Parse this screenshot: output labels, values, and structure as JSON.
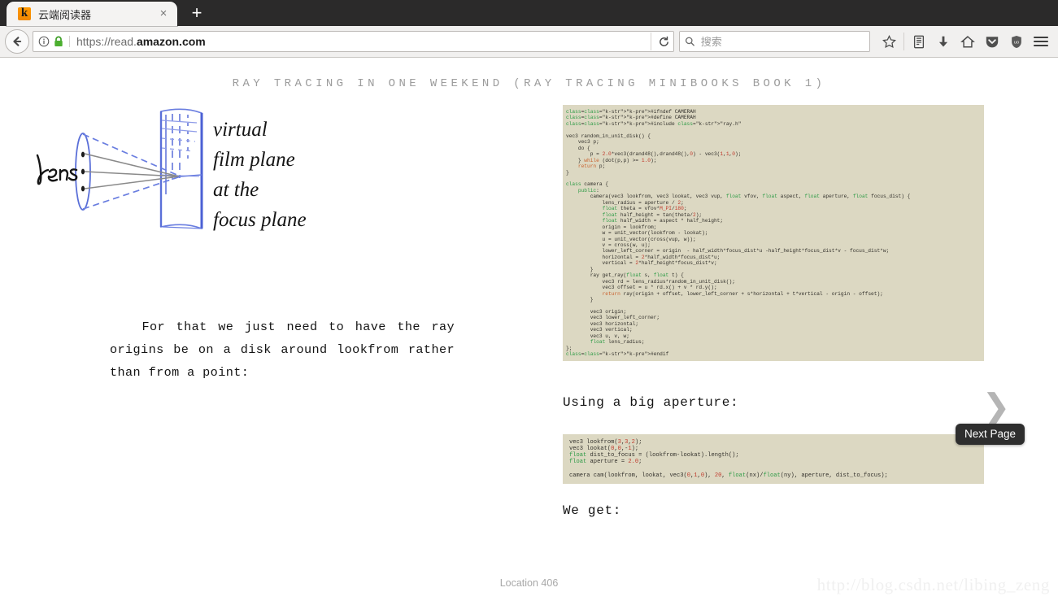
{
  "browser": {
    "tab": {
      "title": "云端阅读器",
      "favicon": "kindle-logo-icon",
      "close_label": "×"
    },
    "newtab_label": "+",
    "nav": {
      "back_icon": "back-arrow-icon",
      "info_icon": "page-info-icon",
      "lock_icon": "padlock-secure-icon",
      "reload_icon": "reload-icon",
      "url_prefix": "https://read.",
      "url_domain": "amazon.com",
      "bookmark_icon": "star-icon",
      "library_icon": "library-icon",
      "download_icon": "download-arrow-icon",
      "home_icon": "home-icon",
      "pocket_icon": "pocket-icon",
      "shield_icon": "ublock-shield-icon",
      "menu_icon": "hamburger-menu-icon"
    },
    "search": {
      "icon": "search-icon",
      "placeholder": "搜索",
      "value": ""
    }
  },
  "reader": {
    "book_title": "RAY TRACING IN ONE WEEKEND (RAY TRACING MINIBOOKS BOOK 1)",
    "figure": {
      "name": "lens-focus-plane-sketch",
      "labels": {
        "lens": "lens",
        "line1": "virtual",
        "line2": "film plane",
        "line3": "at the",
        "line4": "focus plane"
      }
    },
    "paragraph": "For that we just need to have the ray origins be on a disk around lookfrom rather than from a point:",
    "subhead_aperture": "Using a big aperture:",
    "subhead_weget": "We get:",
    "code_camera_h": "#ifndef CAMERAH\n#define CAMERAH\n#include \"ray.h\"\n\nvec3 random_in_unit_disk() {\n    vec3 p;\n    do {\n        p = 2.0*vec3(drand48(),drand48(),0) - vec3(1,1,0);\n    } while (dot(p,p) >= 1.0);\n    return p;\n}\n\nclass camera {\n    public:\n        camera(vec3 lookfrom, vec3 lookat, vec3 vup, float vfov, float aspect, float aperture, float focus_dist) {\n            lens_radius = aperture / 2;\n            float theta = vfov*M_PI/180;\n            float half_height = tan(theta/2);\n            float half_width = aspect * half_height;\n            origin = lookfrom;\n            w = unit_vector(lookfrom - lookat);\n            u = unit_vector(cross(vup, w));\n            v = cross(w, u);\n            lower_left_corner = origin  - half_width*focus_dist*u -half_height*focus_dist*v - focus_dist*w;\n            horizontal = 2*half_width*focus_dist*u;\n            vertical = 2*half_height*focus_dist*v;\n        }\n        ray get_ray(float s, float t) {\n            vec3 rd = lens_radius*random_in_unit_disk();\n            vec3 offset = u * rd.x() + v * rd.y();\n            return ray(origin + offset, lower_left_corner + s*horizontal + t*vertical - origin - offset);\n        }\n\n        vec3 origin;\n        vec3 lower_left_corner;\n        vec3 horizontal;\n        vec3 vertical;\n        vec3 u, v, w;\n        float lens_radius;\n};\n#endif",
    "code_main": "vec3 lookfrom(3,3,2);\nvec3 lookat(0,0,-1);\nfloat dist_to_focus = (lookfrom-lookat).length();\nfloat aperture = 2.0;\n\ncamera cam(lookfrom, lookat, vec3(0,1,0), 20, float(nx)/float(ny), aperture, dist_to_focus);",
    "next_page": {
      "icon": "chevron-right-icon",
      "tooltip": "Next Page"
    },
    "location": "Location 406",
    "watermark": "http://blog.csdn.net/libing_zeng"
  },
  "colors": {
    "chrome_dark": "#2b2a2a",
    "toolbar": "#f1f0ef",
    "code_bg": "#dcd8c2",
    "accent_green": "#43a047",
    "tooltip_bg": "#2e2e2e",
    "title_gray": "#9c9c9c"
  }
}
